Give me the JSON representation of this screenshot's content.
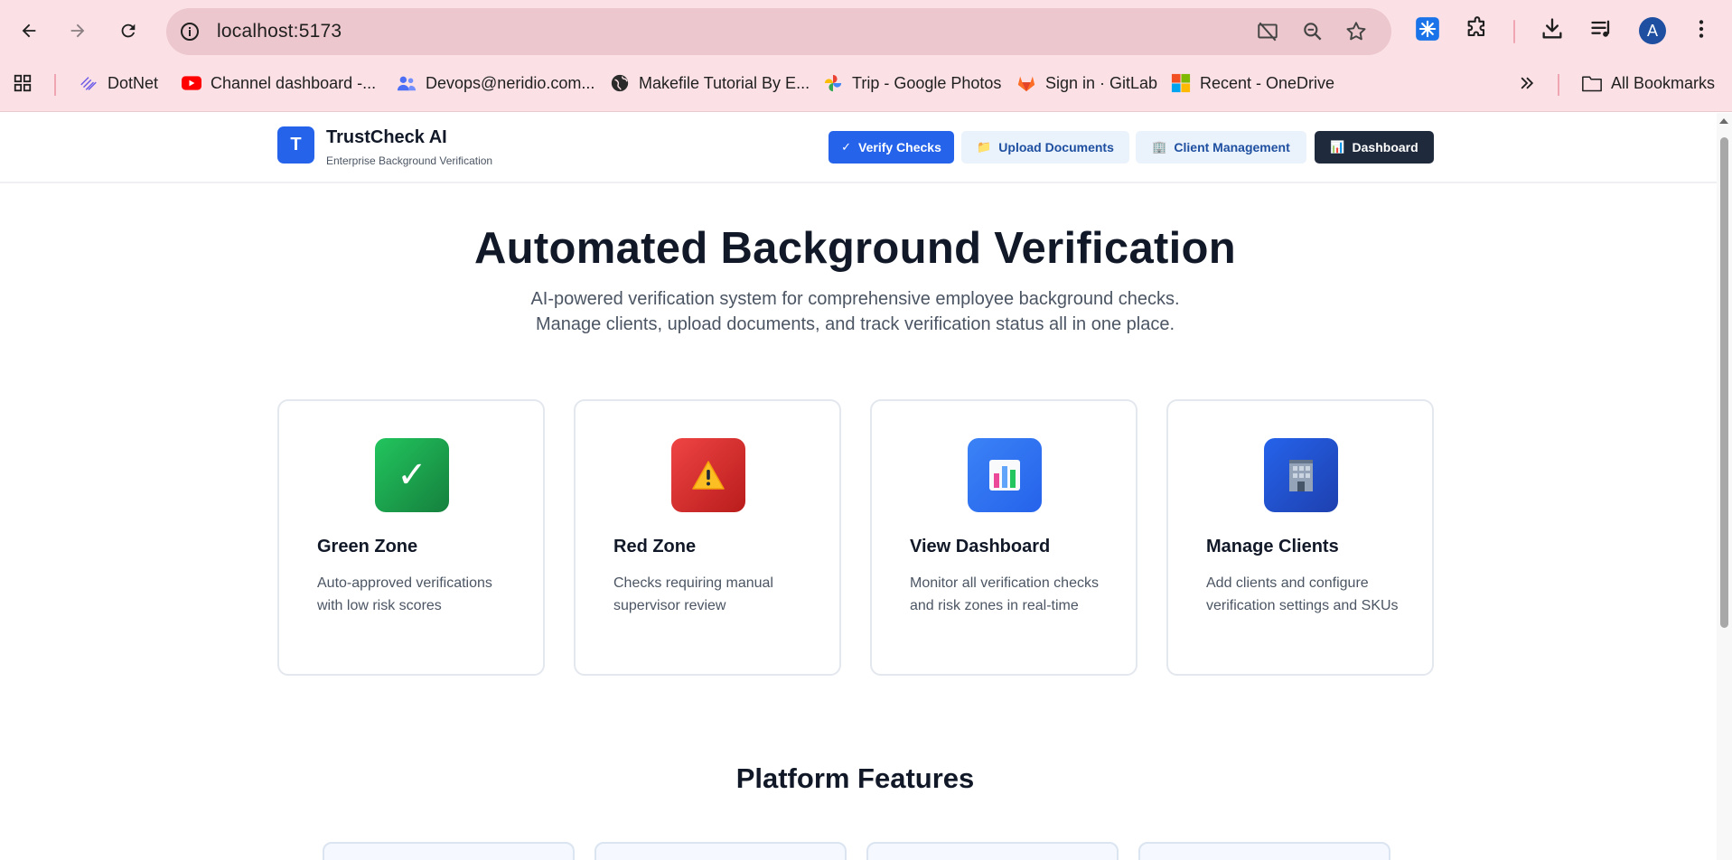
{
  "browser": {
    "url": "localhost:5173",
    "profile_initial": "A",
    "bookmarks": [
      {
        "label": "DotNet",
        "icon": "dotnet-icon"
      },
      {
        "label": "Channel dashboard -...",
        "icon": "youtube-icon"
      },
      {
        "label": "Devops@neridio.com...",
        "icon": "people-icon"
      },
      {
        "label": "Makefile Tutorial By E...",
        "icon": "globe-icon"
      },
      {
        "label": "Trip - Google Photos",
        "icon": "google-photos-icon"
      },
      {
        "label": "Sign in · GitLab",
        "icon": "gitlab-icon"
      },
      {
        "label": "Recent - OneDrive",
        "icon": "microsoft-icon"
      }
    ],
    "all_bookmarks_label": "All Bookmarks"
  },
  "app": {
    "logo_letter": "T",
    "name": "TrustCheck AI",
    "tagline": "Enterprise Background Verification",
    "nav": [
      {
        "label": "Verify Checks",
        "icon": "✓"
      },
      {
        "label": "Upload Documents",
        "icon": "📁"
      },
      {
        "label": "Client Management",
        "icon": "🏢"
      },
      {
        "label": "Dashboard",
        "icon": "📊"
      }
    ]
  },
  "hero": {
    "title": "Automated Background Verification",
    "subtitle_line1": "AI-powered verification system for comprehensive employee background checks.",
    "subtitle_line2": "Manage clients, upload documents, and track verification status all in one place."
  },
  "cards": [
    {
      "title": "Green Zone",
      "desc": "Auto-approved verifications with low risk scores",
      "icon": "checkmark-icon",
      "icon_glyph": "✓",
      "color": "#16a34a"
    },
    {
      "title": "Red Zone",
      "desc": "Checks requiring manual supervisor review",
      "icon": "warning-icon",
      "icon_glyph": "⚠",
      "color": "#dc2626"
    },
    {
      "title": "View Dashboard",
      "desc": "Monitor all verification checks and risk zones in real-time",
      "icon": "bar-chart-icon",
      "icon_glyph": "📊",
      "color": "#3b82f6"
    },
    {
      "title": "Manage Clients",
      "desc": "Add clients and configure verification settings and SKUs",
      "icon": "building-icon",
      "icon_glyph": "🏢",
      "color": "#1d4ed8"
    }
  ],
  "features": {
    "title": "Platform Features"
  },
  "colors": {
    "primary": "#2563eb",
    "dark_button": "#1f2a3c",
    "light_button": "#eaf2fb",
    "chrome_bg": "#fbe1e6"
  }
}
